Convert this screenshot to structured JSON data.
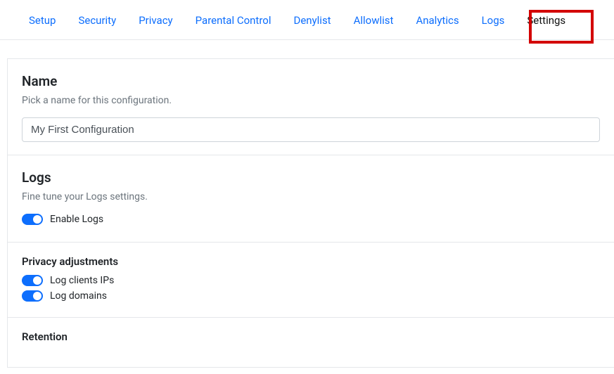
{
  "tabs": [
    "Setup",
    "Security",
    "Privacy",
    "Parental Control",
    "Denylist",
    "Allowlist",
    "Analytics",
    "Logs",
    "Settings"
  ],
  "active_tab_index": 8,
  "highlighted_tab_index": 8,
  "name_section": {
    "title": "Name",
    "description": "Pick a name for this configuration.",
    "value": "My First Configuration"
  },
  "logs_section": {
    "title": "Logs",
    "description": "Fine tune your Logs settings.",
    "enable_logs": {
      "label": "Enable Logs",
      "on": true
    }
  },
  "privacy_section": {
    "title": "Privacy adjustments",
    "log_clients_ips": {
      "label": "Log clients IPs",
      "on": true
    },
    "log_domains": {
      "label": "Log domains",
      "on": true
    }
  },
  "retention_section": {
    "title": "Retention"
  }
}
